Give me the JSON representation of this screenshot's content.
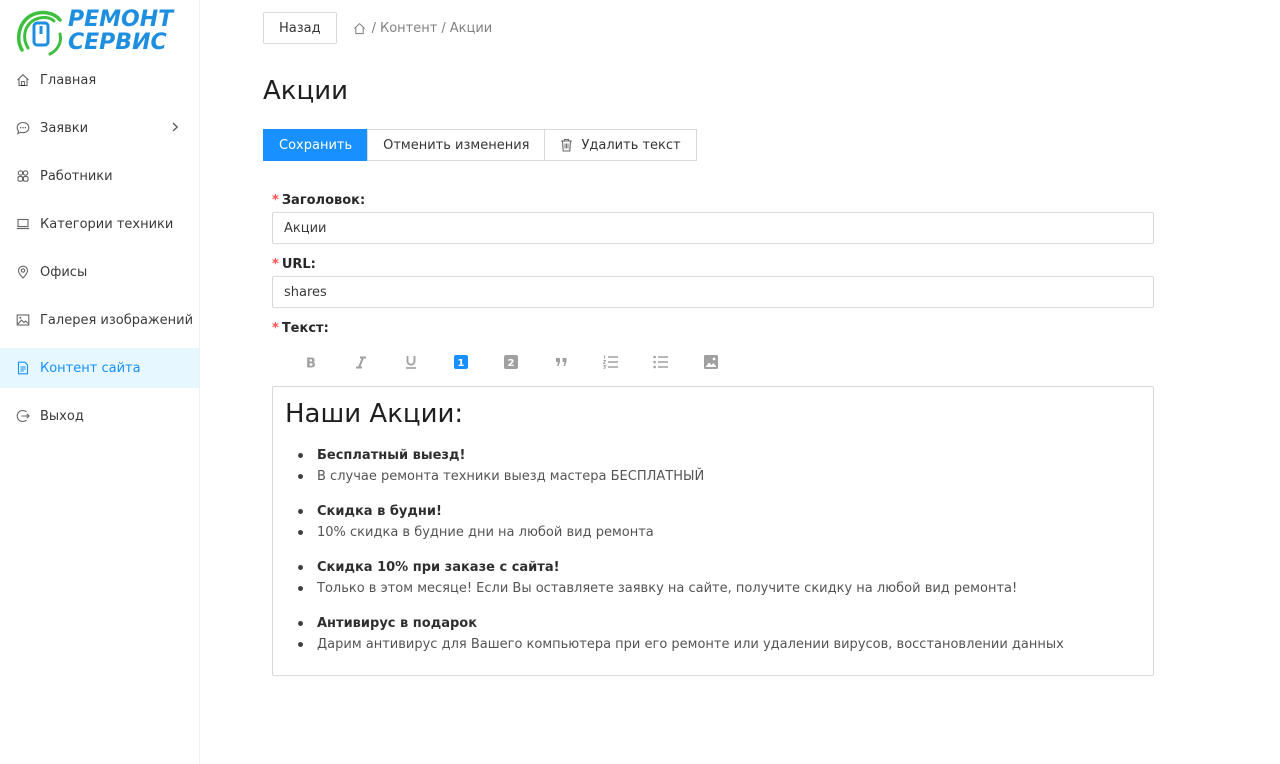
{
  "brand": {
    "line1": "РЕМОНТ",
    "line2": "СЕРВИС",
    "primary_color": "#1d8ee0",
    "accent_color": "#3fbf3f"
  },
  "sidebar": {
    "items": [
      {
        "label": "Главная",
        "icon": "home-icon"
      },
      {
        "label": "Заявки",
        "icon": "chat-icon",
        "has_submenu": true
      },
      {
        "label": "Работники",
        "icon": "team-icon"
      },
      {
        "label": "Категории техники",
        "icon": "laptop-icon"
      },
      {
        "label": "Офисы",
        "icon": "location-icon"
      },
      {
        "label": "Галерея изображений",
        "icon": "picture-icon"
      },
      {
        "label": "Контент сайта",
        "icon": "file-text-icon",
        "active": true
      },
      {
        "label": "Выход",
        "icon": "logout-icon"
      }
    ]
  },
  "header": {
    "back_label": "Назад",
    "breadcrumb": [
      "Контент",
      "Акции"
    ],
    "separator": "/"
  },
  "page": {
    "title": "Акции"
  },
  "actions": {
    "save": "Сохранить",
    "cancel": "Отменить изменения",
    "delete": "Удалить текст"
  },
  "form": {
    "required_mark": "*",
    "title_label": "Заголовок",
    "title_value": "Акции",
    "url_label": "URL",
    "url_value": "shares",
    "text_label": "Текст",
    "colon": ":"
  },
  "toolbar": {
    "buttons": [
      "bold-icon",
      "italic-icon",
      "underline-icon",
      "heading-1-icon",
      "heading-2-icon",
      "quote-icon",
      "ordered-list-icon",
      "bullet-list-icon",
      "image-icon"
    ],
    "active": "heading-1-icon",
    "h1_glyph": "1",
    "h2_glyph": "2"
  },
  "editor": {
    "heading": "Наши Акции:",
    "promos": [
      {
        "title": "Бесплатный выезд!",
        "text": "В случае ремонта техники выезд мастера БЕСПЛАТНЫЙ"
      },
      {
        "title": "Скидка в будни!",
        "text": "10% скидка в будние дни на любой вид ремонта"
      },
      {
        "title": "Скидка 10% при заказе с сайта!",
        "text": "Только в этом месяце! Если Вы оставляете заявку на сайте, получите скидку на любой вид ремонта!"
      },
      {
        "title": "Антивирус в подарок",
        "text": "Дарим антивирус для Вашего компьютера при его ремонте или удалении вирусов, восстановлении данных"
      }
    ]
  }
}
